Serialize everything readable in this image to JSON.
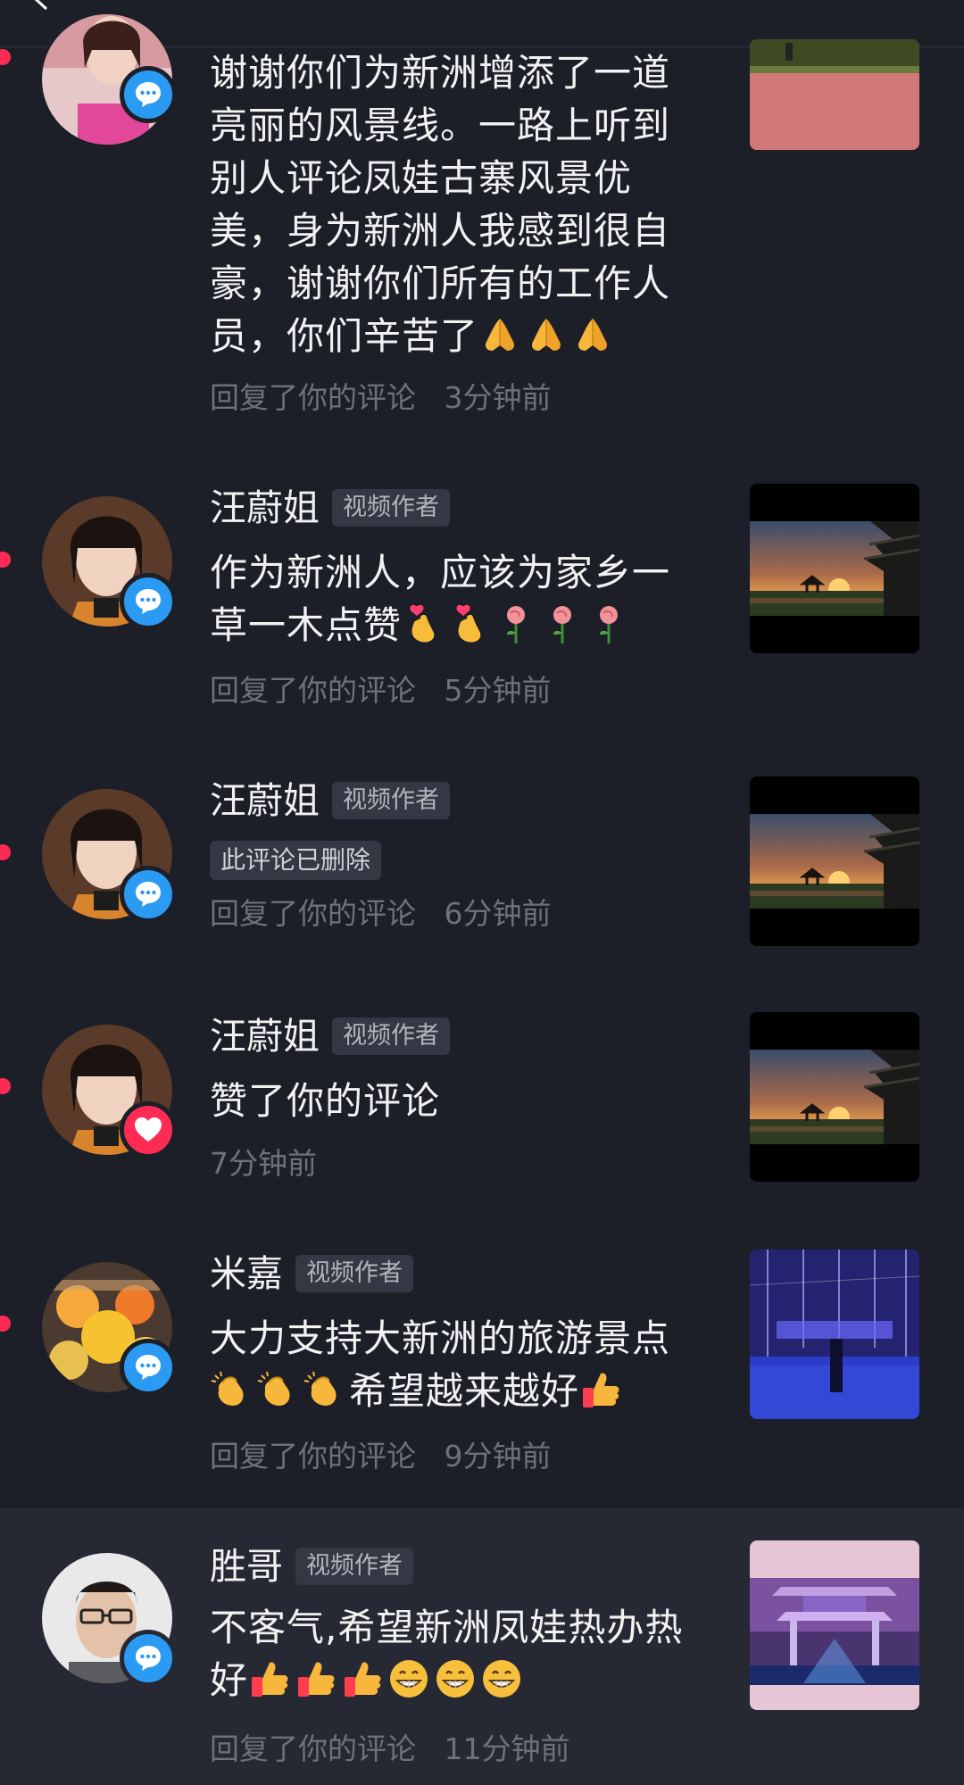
{
  "colors": {
    "background": "#1c1e28",
    "highlight_row": "#262833",
    "unread_dot": "#fe2c55",
    "comment_badge": "#2a9af3",
    "like_badge": "#fe2c55",
    "meta_text": "#6e717b"
  },
  "notifications": [
    {
      "text": "谢谢你们为新洲增添了一道亮丽的风景线。一路上听到别人评论凤娃古寨风景优美，身为新洲人我感到很自豪，谢谢你们所有的工作人员，你们辛苦了",
      "emojis": [
        "folded-hands-emoji",
        "folded-hands-emoji",
        "folded-hands-emoji"
      ],
      "action": "回复了你的评论",
      "time": "3分钟前",
      "badge_icon": "comment-icon"
    },
    {
      "username": "汪蔚姐",
      "tag": "视频作者",
      "text": "作为新洲人，应该为家乡一草一木点赞",
      "emojis": [
        "finger-heart-emoji",
        "finger-heart-emoji",
        "rose-emoji",
        "rose-emoji",
        "rose-emoji"
      ],
      "action": "回复了你的评论",
      "time": "5分钟前",
      "badge_icon": "comment-icon"
    },
    {
      "username": "汪蔚姐",
      "tag": "视频作者",
      "deleted_label": "此评论已删除",
      "action": "回复了你的评论",
      "time": "6分钟前",
      "badge_icon": "comment-icon"
    },
    {
      "username": "汪蔚姐",
      "tag": "视频作者",
      "text": "赞了你的评论",
      "time": "7分钟前",
      "badge_icon": "heart-icon"
    },
    {
      "username": "米嘉",
      "tag": "视频作者",
      "text_line1": "大力支持大新洲的旅游景点",
      "emojis_a": [
        "clapping-hands-emoji",
        "clapping-hands-emoji",
        "clapping-hands-emoji"
      ],
      "text_line2": "希望越来越好",
      "emojis_b": [
        "thumbs-up-emoji"
      ],
      "action": "回复了你的评论",
      "time": "9分钟前",
      "badge_icon": "comment-icon"
    },
    {
      "username": "胜哥",
      "tag": "视频作者",
      "text_line1": "不客气,希望新洲凤娃热办热",
      "text_line2": "好",
      "emojis": [
        "thumbs-up-emoji",
        "thumbs-up-emoji",
        "thumbs-up-emoji",
        "grinning-face-emoji",
        "grinning-face-emoji",
        "grinning-face-emoji"
      ],
      "action": "回复了你的评论",
      "time": "11分钟前",
      "badge_icon": "comment-icon"
    }
  ]
}
